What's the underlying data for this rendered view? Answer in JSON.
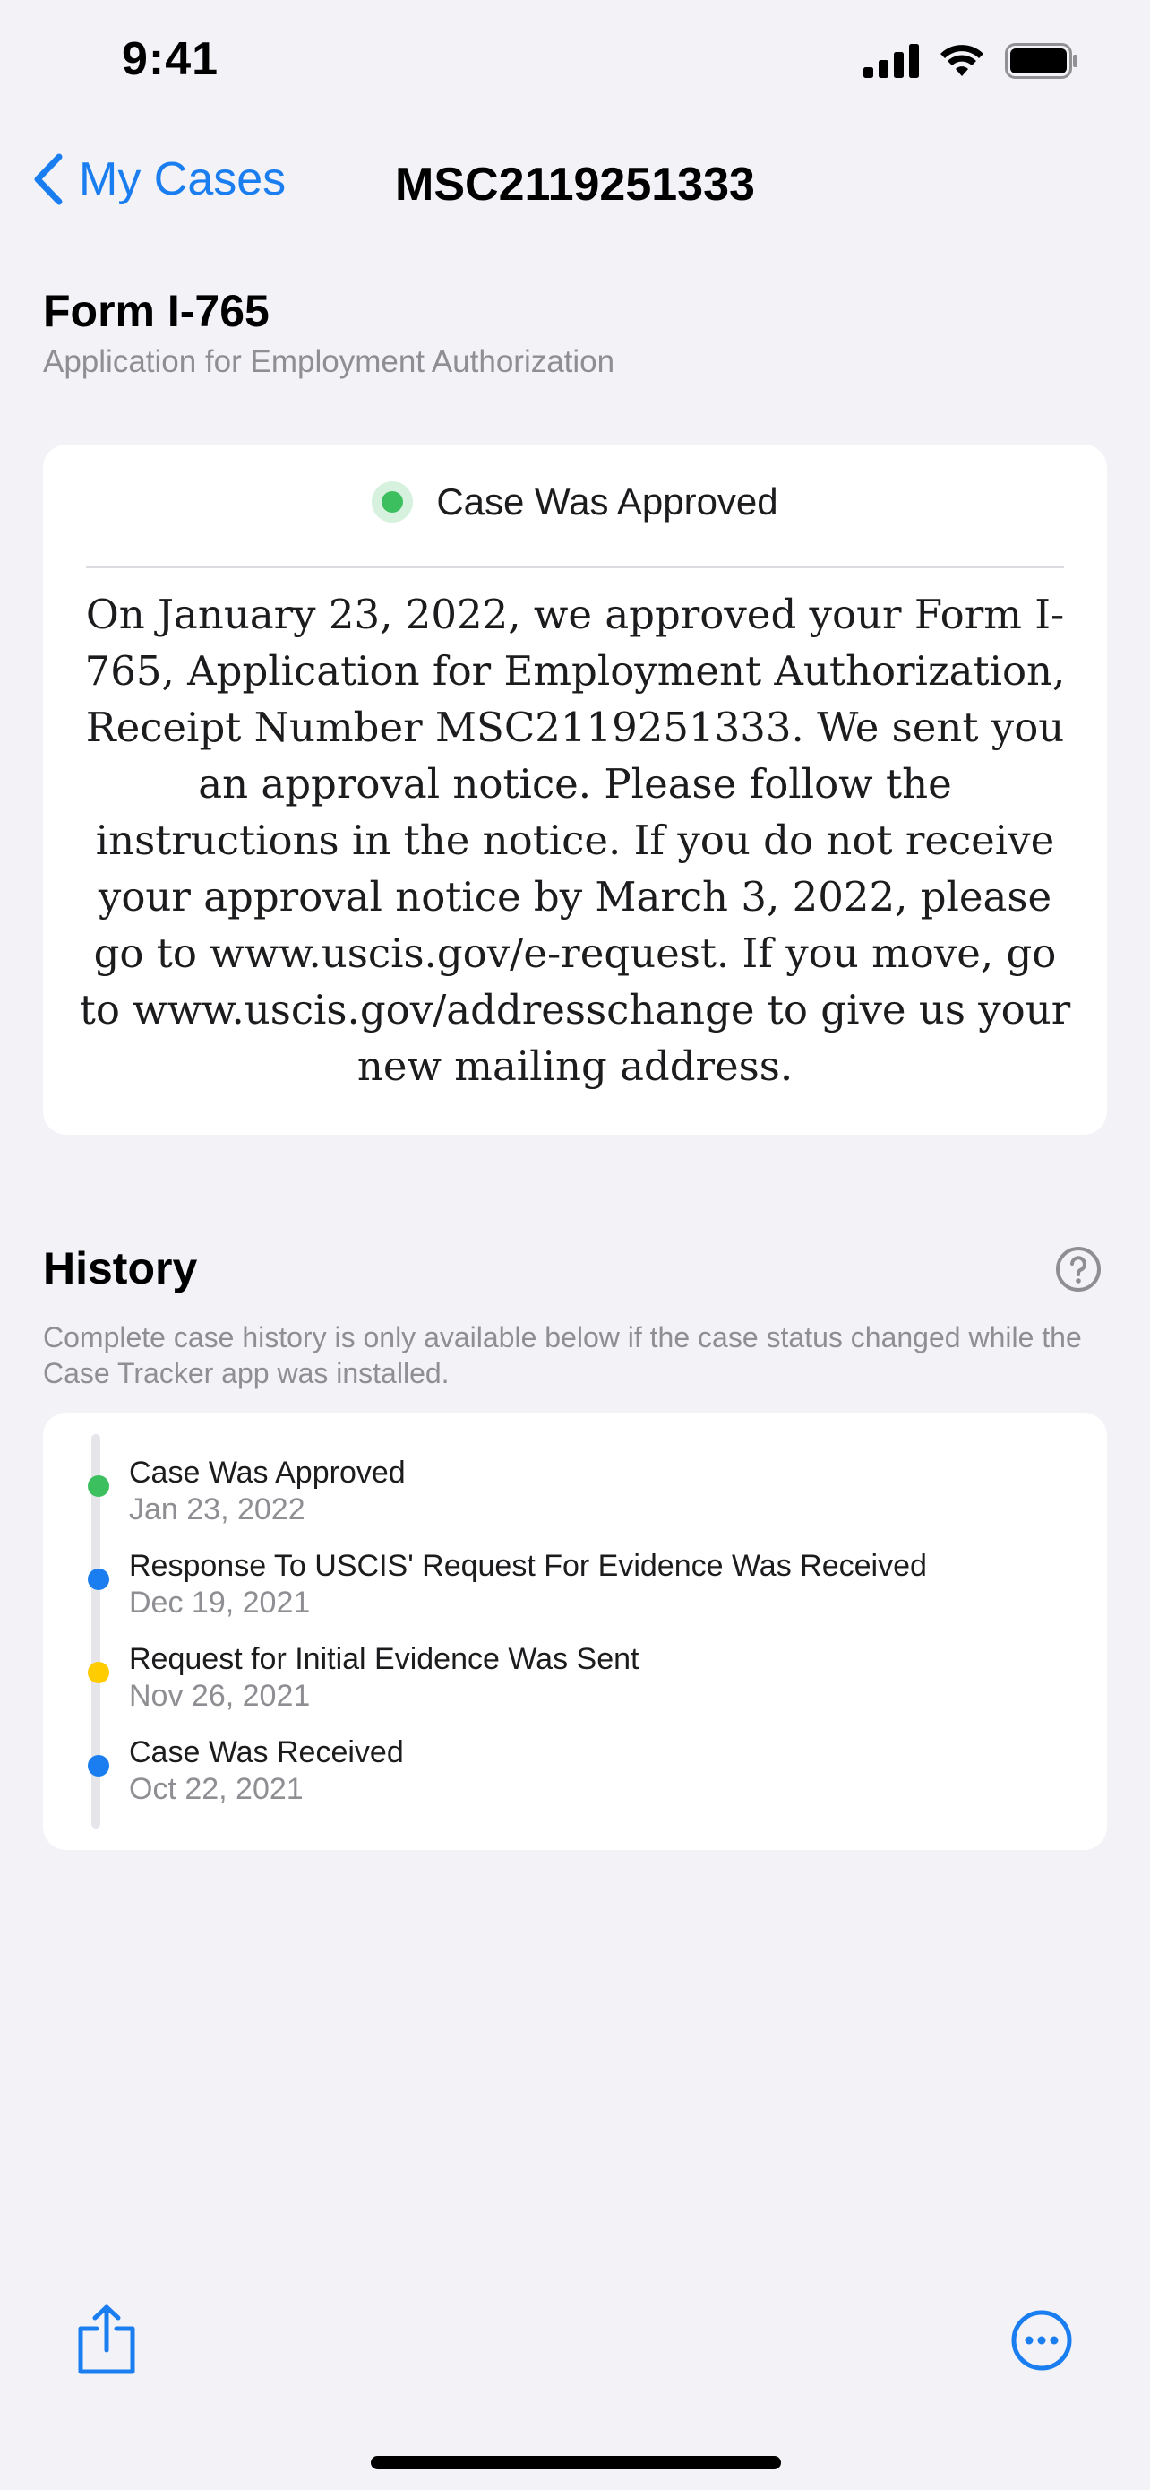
{
  "status_bar": {
    "time": "9:41",
    "icons": [
      "signal-icon",
      "wifi-icon",
      "battery-icon"
    ]
  },
  "nav": {
    "back_label": "My Cases",
    "title": "MSC2119251333"
  },
  "form": {
    "title": "Form I-765",
    "subtitle": "Application for Employment Authorization"
  },
  "status_card": {
    "status": "Case Was Approved",
    "status_color": "#3cbf5f",
    "body": "On January 23, 2022, we approved your Form I-765, Application for Employment Authorization, Receipt Number MSC2119251333. We sent you an approval notice. Please follow the instructions in the notice. If you do not receive your approval notice by March 3, 2022, please go to www.uscis.gov/e-request. If you move, go to www.uscis.gov/addresschange to give us your new mailing address."
  },
  "history": {
    "title": "History",
    "note": "Complete case history is only available below if the case status changed while the Case Tracker app was installed.",
    "events": [
      {
        "title": "Case Was Approved",
        "date": "Jan 23, 2022",
        "color": "#3cbf5f"
      },
      {
        "title": "Response To USCIS' Request For Evidence Was Received",
        "date": "Dec 19, 2021",
        "color": "#1a7ef0"
      },
      {
        "title": "Request for Initial Evidence Was Sent",
        "date": "Nov 26, 2021",
        "color": "#ffcc00"
      },
      {
        "title": "Case Was Received",
        "date": "Oct 22, 2021",
        "color": "#1a7ef0"
      }
    ]
  },
  "toolbar": {
    "share_icon": "share-icon",
    "more_icon": "more-icon"
  },
  "colors": {
    "accent": "#1a7ef0",
    "background": "#f2f2f7"
  }
}
